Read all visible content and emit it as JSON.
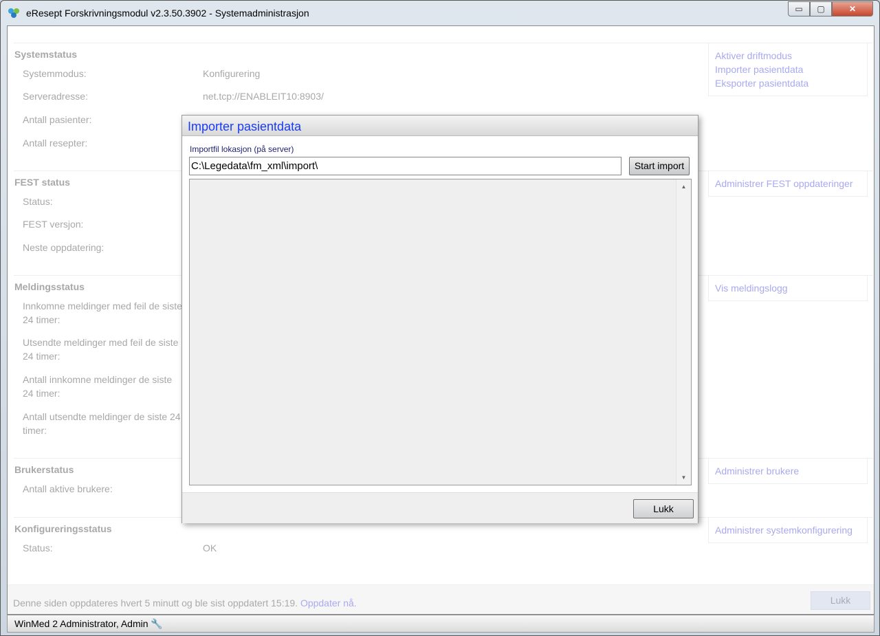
{
  "window": {
    "title": "eResept Forskrivningsmodul v2.3.50.3902 - Systemadministrasjon",
    "minimize": "▭",
    "maximize": "▢",
    "close": "✕"
  },
  "sections": {
    "system": {
      "heading": "Systemstatus",
      "rows": [
        {
          "label": "Systemmodus:",
          "value": "Konfigurering"
        },
        {
          "label": "Serveradresse:",
          "value": "net.tcp://ENABLEIT10:8903/"
        },
        {
          "label": "Antall pasienter:",
          "value": ""
        },
        {
          "label": "Antall resepter:",
          "value": ""
        }
      ],
      "links": [
        "Aktiver driftmodus",
        "Importer pasientdata",
        "Eksporter pasientdata"
      ]
    },
    "fest": {
      "heading": "FEST status",
      "rows": [
        {
          "label": "Status:"
        },
        {
          "label": "FEST versjon:"
        },
        {
          "label": "Neste oppdatering:"
        }
      ],
      "links": [
        "Administrer FEST oppdateringer"
      ]
    },
    "melding": {
      "heading": "Meldingsstatus",
      "rows": [
        {
          "label": "Innkomne meldinger med feil de siste 24 timer:"
        },
        {
          "label": "Utsendte meldinger med feil de siste 24 timer:"
        },
        {
          "label": "Antall innkomne meldinger de siste 24 timer:"
        },
        {
          "label": "Antall utsendte meldinger de siste 24 timer:"
        }
      ],
      "links": [
        "Vis meldingslogg"
      ]
    },
    "bruker": {
      "heading": "Brukerstatus",
      "rows": [
        {
          "label": "Antall aktive brukere:"
        }
      ],
      "links": [
        "Administrer brukere"
      ]
    },
    "konfig": {
      "heading": "Konfigureringsstatus",
      "rows": [
        {
          "label": "Status:",
          "value": "OK"
        }
      ],
      "links": [
        "Administrer systemkonfigurering"
      ]
    }
  },
  "footer": {
    "text": "Denne siden oppdateres hvert 5 minutt og ble sist oppdatert 15:19.",
    "link": "Oppdater nå.",
    "close": "Lukk"
  },
  "statusbar": {
    "user": "WinMed 2 Administrator, Admin",
    "icon": "wrench-icon"
  },
  "dialog": {
    "title": "Importer pasientdata",
    "field_label": "Importfil lokasjon (på server)",
    "field_value": "C:\\Legedata\\fm_xml\\import\\",
    "start": "Start import",
    "close": "Lukk",
    "log": ""
  }
}
